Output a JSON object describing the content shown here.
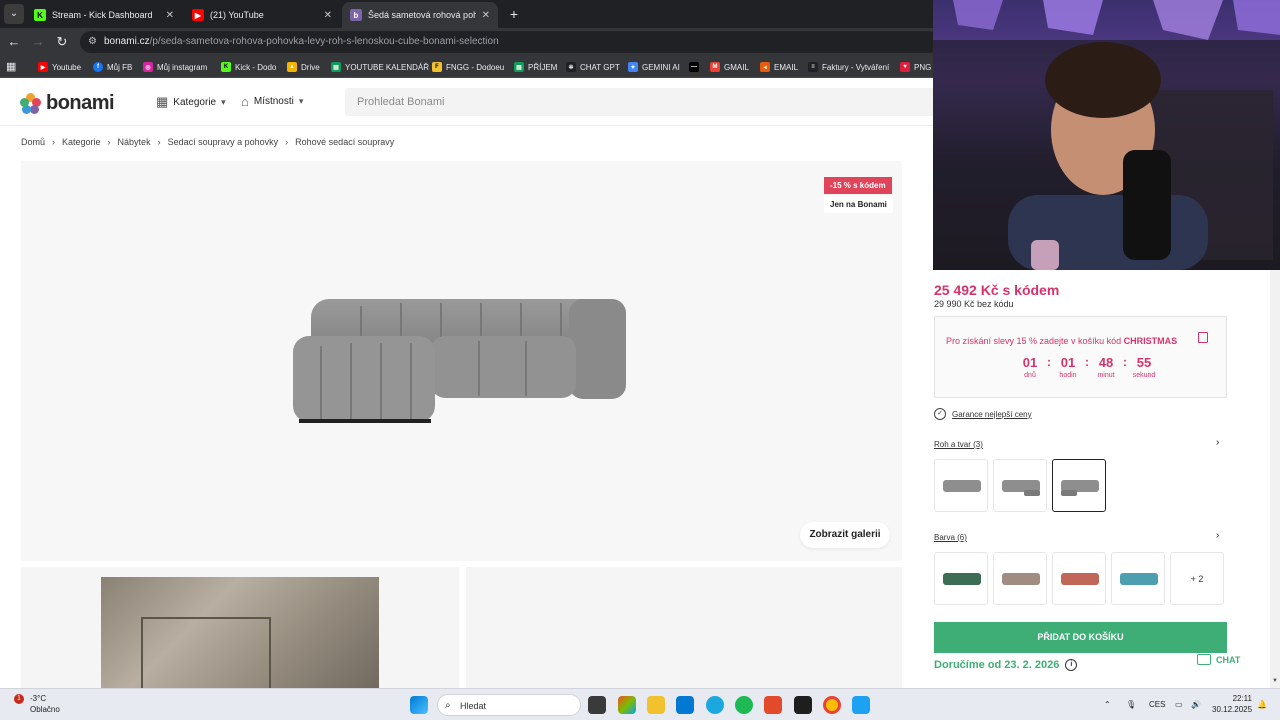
{
  "browser": {
    "tabs": [
      {
        "label": "Stream - Kick Dashboard",
        "active": false,
        "favicon_color": "#53fc18"
      },
      {
        "label": "(21) YouTube",
        "active": false,
        "favicon_color": "#ff0000"
      },
      {
        "label": "Šedá sametová rohová pohovka",
        "active": true,
        "favicon_color": "#7d64a8"
      }
    ],
    "url_host": "bonami.cz",
    "url_path": "/p/seda-sametova-rohova-pohovka-levy-roh-s-lenoskou-cube-bonami-selection",
    "bookmarks": [
      {
        "label": "Youtube",
        "color": "#ff0000"
      },
      {
        "label": "Můj FB",
        "color": "#1877f2"
      },
      {
        "label": "Můj instagram",
        "color": "#d6249f"
      },
      {
        "label": "Kick - Dodo",
        "color": "#53fc18"
      },
      {
        "label": "Drive",
        "color": "#f4b400"
      },
      {
        "label": "YOUTUBE KALENDÁŘ",
        "color": "#0f9d58"
      },
      {
        "label": "FNGG - Dodoeu",
        "color": "#f2c12e"
      },
      {
        "label": "PŘÍJEM",
        "color": "#0f9d58"
      },
      {
        "label": "CHAT GPT",
        "color": "#202124"
      },
      {
        "label": "GEMINI AI",
        "color": "#4285f4"
      },
      {
        "label": "",
        "color": "#000000"
      },
      {
        "label": "GMAIL",
        "color": "#ea4335"
      },
      {
        "label": "EMAIL",
        "color": "#e85d0c"
      },
      {
        "label": "Faktury - Vytváření",
        "color": "#202124"
      },
      {
        "label": "PNG",
        "color": "#e01e3c"
      }
    ]
  },
  "site": {
    "logo": "bonami",
    "nav": {
      "categories": "Kategorie",
      "rooms": "Místnosti"
    },
    "search_placeholder": "Prohledat Bonami",
    "breadcrumb": [
      "Domů",
      "Kategorie",
      "Nábytek",
      "Sedací soupravy a pohovky",
      "Rohové sedací soupravy"
    ],
    "badge_discount": "-15 % s kódem",
    "badge_exclusive": "Jen na Bonami",
    "gallery_button": "Zobrazit galerii",
    "price_code": "25 492 Kč s kódem",
    "price_regular": "29 990 Kč bez kódu",
    "code_text_prefix": "Pro získání slevy 15 % zadejte v košíku kód ",
    "code": "CHRISTMAS",
    "countdown": {
      "days": "01",
      "days_label": "dnů",
      "hours": "01",
      "hours_label": "hodin",
      "minutes": "48",
      "minutes_label": "minut",
      "seconds": "55",
      "seconds_label": "sekund"
    },
    "guarantee": "Garance nejlepší ceny",
    "shape_label": "Roh a tvar (3)",
    "color_label": "Barva (6)",
    "color_more": "+ 2",
    "add_to_cart": "PŘIDAT DO KOŠÍKU",
    "delivery": "Doručíme od 23. 2. 2026",
    "chat": "CHAT",
    "colors": {
      "accent": "#d6336c",
      "green": "#3fae76",
      "sofa": "#8e8e8e"
    },
    "swatch_colors": [
      "#3d6e55",
      "#a08c80",
      "#c0675a",
      "#4d9fb0"
    ]
  },
  "taskbar": {
    "temperature": "-3°C",
    "weather": "Oblačno",
    "notifications": "1",
    "search": "Hledat",
    "language": "CES",
    "time": "22:11",
    "date": "30.12.2025"
  }
}
